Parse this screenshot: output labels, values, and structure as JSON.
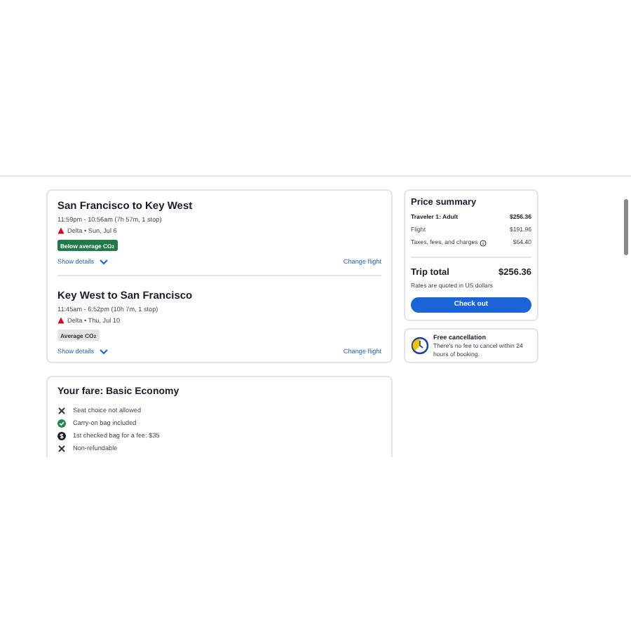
{
  "flights": [
    {
      "title": "San Francisco to Key West",
      "times": "11:59pm - 10:56am (7h 57m, 1 stop)",
      "carrier": "Delta • Sun, Jul 6",
      "co2": {
        "label": "Below average CO$_{2}$",
        "kind": "below"
      },
      "details": "Show details",
      "change": "Change flight"
    },
    {
      "title": "Key West to San Francisco",
      "times": "11:45am - 6:52pm (10h 7m, 1 stop)",
      "carrier": "Delta • Thu, Jul 10",
      "co2": {
        "label": "Average CO$_{2}$",
        "kind": "average"
      },
      "details": "Show details",
      "change": "Change flight"
    }
  ],
  "fare": {
    "title": "Your fare: Basic Economy",
    "items": [
      {
        "kind": "no",
        "text": "Seat choice not allowed"
      },
      {
        "kind": "yes",
        "text": "Carry-on bag included"
      },
      {
        "kind": "fee",
        "text": "1st checked bag for a fee: $35"
      },
      {
        "kind": "no",
        "text": "Non-refundable"
      }
    ]
  },
  "price_summary": {
    "title": "Price summary",
    "rows": [
      {
        "label": "Traveler 1: Adult",
        "value": "$256.36",
        "bold": true,
        "info": false
      },
      {
        "label": "Flight",
        "value": "$191.96",
        "bold": false,
        "info": false
      },
      {
        "label": "Taxes, fees, and charges",
        "value": "$64.40",
        "bold": false,
        "info": true
      }
    ],
    "total_label": "Trip total",
    "total_value": "$256.36",
    "note": "Rates are quoted in US dollars",
    "button": "Check out"
  },
  "cancellation": {
    "title": "Free cancellation",
    "text": "There's no fee to cancel within 24 hours of booking."
  }
}
